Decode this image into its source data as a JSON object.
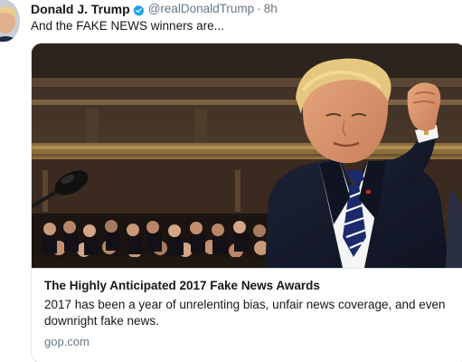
{
  "tweet": {
    "display_name": "Donald J. Trump",
    "handle": "@realDonaldTrump",
    "separator": "·",
    "timestamp": "8h",
    "text": "And the FAKE NEWS winners are...",
    "verified": true
  },
  "card": {
    "title": "The Highly Anticipated 2017 Fake News Awards",
    "description": "2017 has been a year of unrelenting bias, unfair news coverage, and even downright fake news.",
    "domain": "gop.com"
  },
  "colors": {
    "verified_badge": "#1da1f2",
    "secondary_text": "#657786",
    "card_border": "#e1e8ed"
  }
}
